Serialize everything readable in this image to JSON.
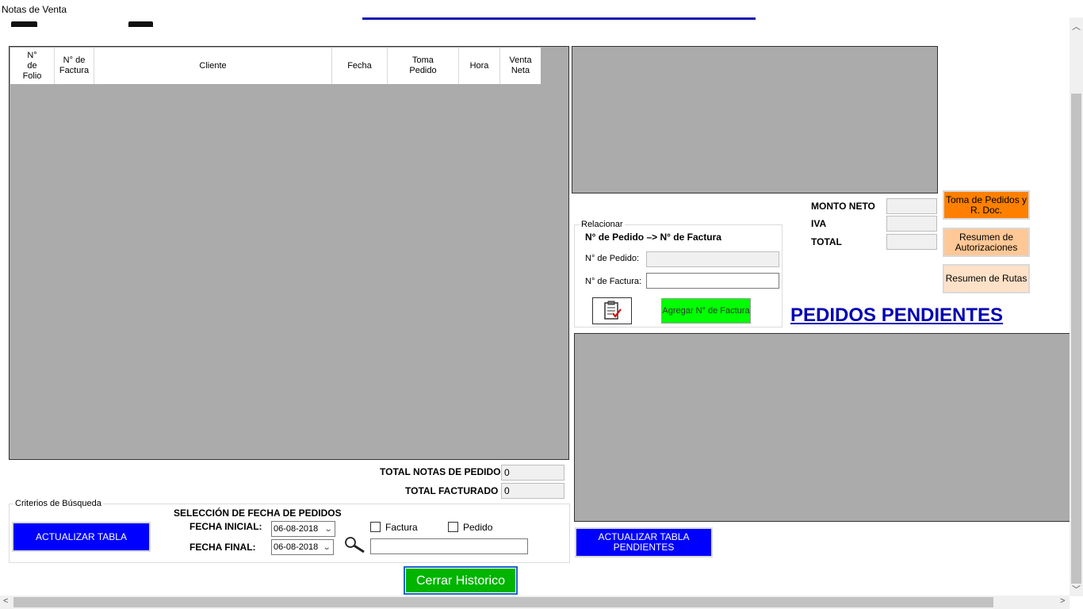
{
  "window": {
    "title": "Notas de Venta"
  },
  "grid": {
    "columns": [
      "N°\nde\nFolio",
      "N° de\nFactura",
      "Cliente",
      "Fecha",
      "Toma\nPedido",
      "Hora",
      "Venta\nNeta"
    ]
  },
  "totals_right": {
    "monto_neto_label": "MONTO NETO",
    "iva_label": "IVA",
    "total_label": "TOTAL"
  },
  "buttons_right": {
    "toma_pedidos": "Toma de Pedidos y R. Doc.",
    "resumen_autorizaciones": "Resumen de Autorizaciones",
    "resumen_rutas": "Resumen de Rutas"
  },
  "relacionar": {
    "group_title": "Relacionar",
    "heading": "N° de Pedido –> N° de Factura",
    "pedido_label": "N° de Pedido:",
    "pedido_value": "",
    "factura_label": "N° de Factura:",
    "factura_value": "",
    "agregar_button": "Agregar N° de Factura"
  },
  "pendientes": {
    "heading": "PEDIDOS PENDIENTES",
    "actualizar_button": "ACTUALIZAR TABLA PENDIENTES"
  },
  "totals_bottom": {
    "total_notas_label": "TOTAL NOTAS DE PEDIDO",
    "total_notas_value": "0",
    "total_facturado_label": "TOTAL FACTURADO",
    "total_facturado_value": "0"
  },
  "criterios": {
    "group_title": "Criterios de Búsqueda",
    "actualizar_button": "ACTUALIZAR TABLA",
    "seleccion_heading": "SELECCIÓN DE FECHA DE PEDIDOS",
    "fecha_inicial_label": "FECHA INICIAL:",
    "fecha_inicial_value": "06-08-2018",
    "fecha_final_label": "FECHA FINAL:",
    "fecha_final_value": "06-08-2018",
    "factura_checkbox": "Factura",
    "pedido_checkbox": "Pedido",
    "search_value": ""
  },
  "footer": {
    "cerrar_button": "Cerrar Historico"
  },
  "icons": {
    "search": "magnifier-icon",
    "clipboard": "clipboard-check-icon"
  },
  "colors": {
    "blue_button": "#0000ff",
    "green_button": "#00ff00",
    "dark_green_button": "#00b400",
    "orange_button": "#ff8000",
    "peach_button": "#ffc896",
    "light_peach_button": "#ffe1c8",
    "header_link": "#0000b4"
  }
}
